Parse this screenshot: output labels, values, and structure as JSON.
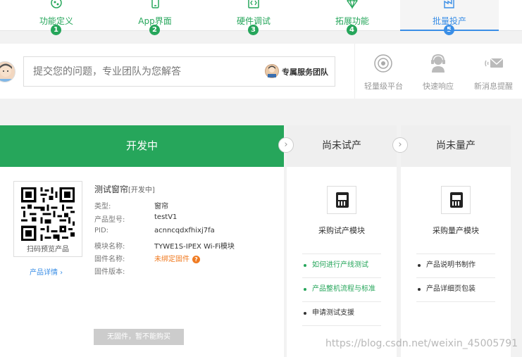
{
  "stepper": {
    "steps": [
      {
        "label": "功能定义",
        "num": "1"
      },
      {
        "label": "App界面",
        "num": "2"
      },
      {
        "label": "硬件调试",
        "num": "3"
      },
      {
        "label": "拓展功能",
        "num": "4"
      },
      {
        "label": "批量投产",
        "num": "5"
      }
    ],
    "active_color": "#3a8ee6",
    "done_color": "#26a65b"
  },
  "service": {
    "question_placeholder": "提交您的问题，专业团队为您解答",
    "team_label": "专属服务团队",
    "features": [
      {
        "label": "轻量级平台",
        "icon": "target-icon"
      },
      {
        "label": "快速响应",
        "icon": "support-agent-icon"
      },
      {
        "label": "新消息提醒",
        "icon": "mail-bell-icon"
      }
    ]
  },
  "status": {
    "dev_label": "开发中",
    "trial_label": "尚未试产",
    "mass_label": "尚未量产",
    "dev_color": "#26a65b"
  },
  "product": {
    "qr_caption": "扫码预览产品",
    "details_link": "产品详情 ›",
    "name": "测试窗帘",
    "state_tag": "[开发中]",
    "fields": [
      {
        "key": "类型:",
        "value": "窗帘"
      },
      {
        "key": "产品型号:",
        "value": "testV1"
      },
      {
        "key": "PID:",
        "value": "acnncqdxfhixj7fa"
      },
      {
        "key": "模块名称:",
        "value": "TYWE1S-IPEX Wi-Fi模块"
      },
      {
        "key": "固件名称:",
        "value": "未绑定固件"
      },
      {
        "key": "固件版本:",
        "value": ""
      }
    ],
    "buy_button": "无固件，暂不能购买"
  },
  "trial": {
    "module_title": "采购试产模块",
    "items": [
      "如何进行产线测试",
      "产品整机流程与标准",
      "申请测试支援"
    ]
  },
  "mass": {
    "module_title": "采购量产模块",
    "items": [
      "产品说明书制作",
      "产品详细页包装"
    ]
  },
  "watermark": "https://blog.csdn.net/weixin_45005791"
}
